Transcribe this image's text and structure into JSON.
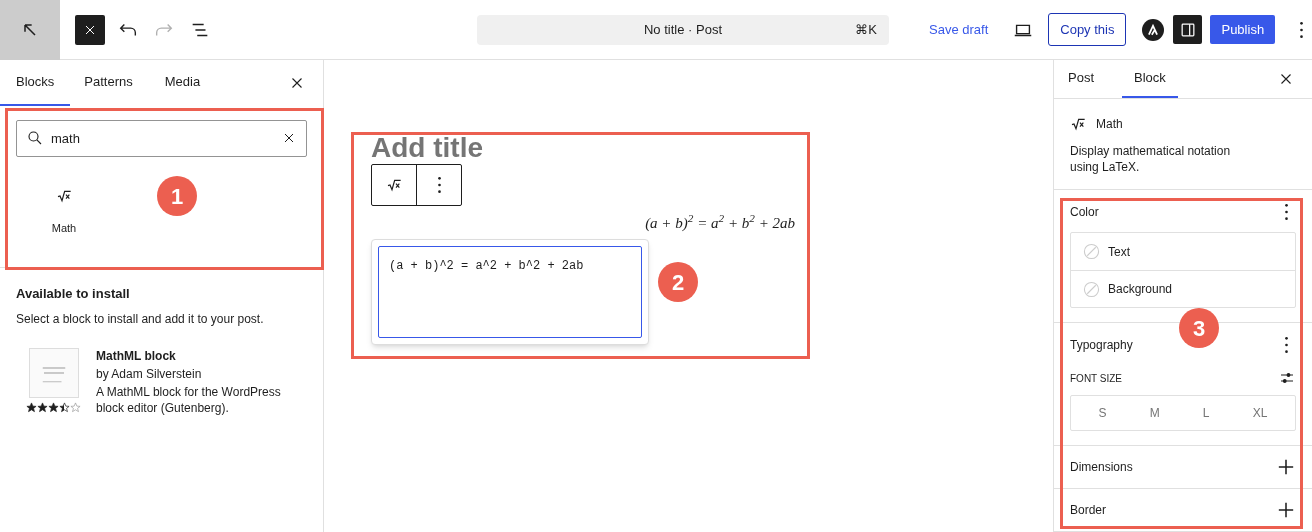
{
  "toolbar": {
    "document_title": "No title · Post",
    "shortcut": "⌘K",
    "save_draft": "Save draft",
    "copy_button": "Copy this",
    "publish": "Publish",
    "redo_disabled": true,
    "sidebar_toggle_on": true
  },
  "inserter": {
    "tabs": [
      {
        "label": "Blocks",
        "selected": true
      },
      {
        "label": "Patterns",
        "selected": false
      },
      {
        "label": "Media",
        "selected": false
      }
    ],
    "search": {
      "value": "math"
    },
    "results": [
      {
        "label": "Math"
      }
    ],
    "install": {
      "heading": "Available to install",
      "description": "Select a block to install and add it to your post.",
      "plugins": [
        {
          "name": "MathML block",
          "author": "by Adam Silverstein",
          "description": "A MathML block for the WordPress block editor (Gutenberg).",
          "stars": 3.5
        }
      ]
    }
  },
  "editor": {
    "title_placeholder": "Add title",
    "formula": "(a + b)$^{2}$ = a$^{2}$ + b$^{2}$ + 2ab",
    "latex_source": "(a + b)^2 = a^2 + b^2 + 2ab"
  },
  "settings": {
    "tabs": [
      {
        "label": "Post",
        "selected": false
      },
      {
        "label": "Block",
        "selected": true
      }
    ],
    "block": {
      "name": "Math",
      "description": "Display mathematical notation using LaTeX."
    },
    "panels": [
      {
        "kind": "color",
        "title": "Color",
        "expanded": true,
        "items": [
          {
            "label": "Text"
          },
          {
            "label": "Background"
          }
        ]
      },
      {
        "kind": "typography",
        "title": "Typography",
        "expanded": true,
        "font_size_label": "FONT SIZE",
        "sizes": [
          "S",
          "M",
          "L",
          "XL"
        ]
      },
      {
        "kind": "collapsed",
        "title": "Dimensions",
        "expanded": false
      },
      {
        "kind": "collapsed",
        "title": "Border",
        "expanded": false
      }
    ]
  },
  "annotations": [
    {
      "number": "1"
    },
    {
      "number": "2"
    },
    {
      "number": "3"
    }
  ]
}
